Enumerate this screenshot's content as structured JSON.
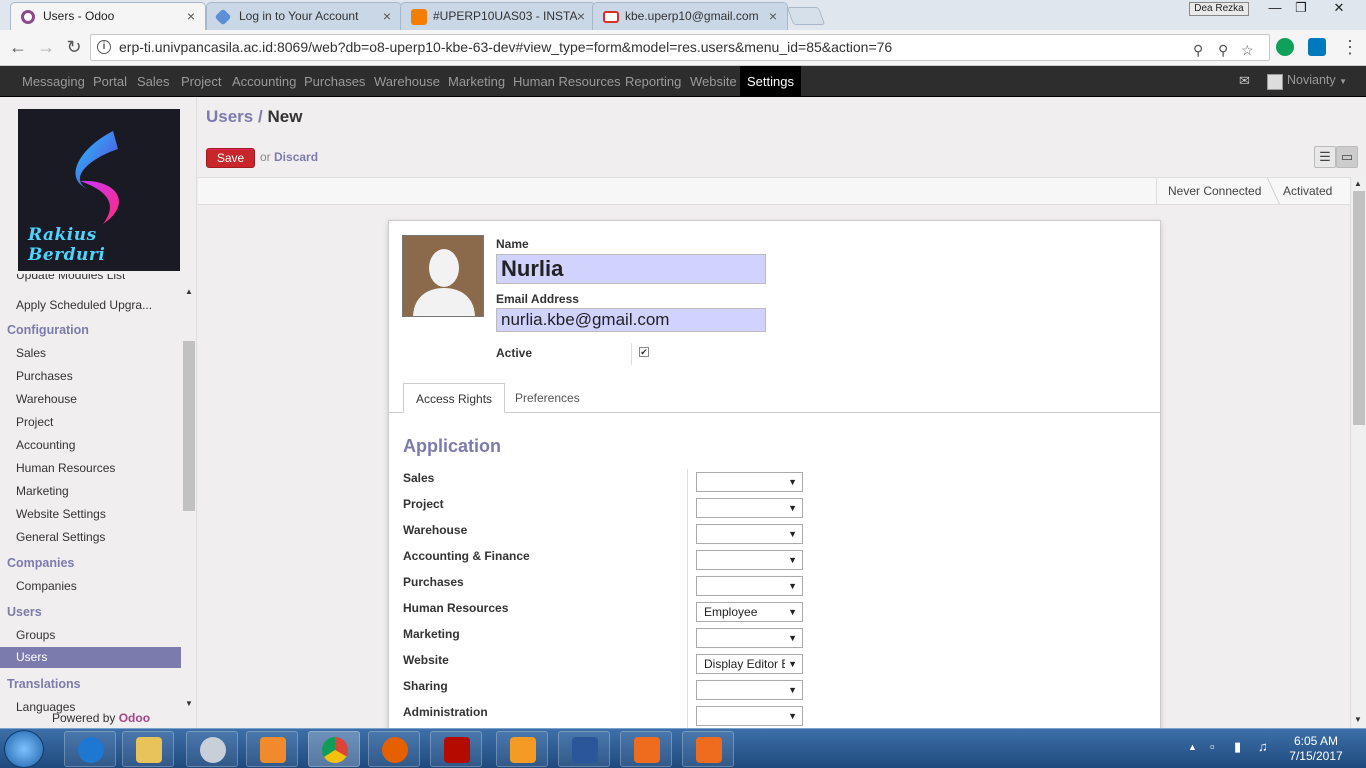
{
  "browser": {
    "tabs": [
      {
        "title": "Users - Odoo",
        "close": "×"
      },
      {
        "title": "Log in to Your Account",
        "close": "×"
      },
      {
        "title": "#UPERP10UAS03 - INSTA",
        "close": "×"
      },
      {
        "title": "kbe.uperp10@gmail.com",
        "close": "×"
      }
    ],
    "profile_name": "Dea Rezka",
    "url": "erp-ti.univpancasila.ac.id:8069/web?db=o8-uperp10-kbe-63-dev#view_type=form&model=res.users&menu_id=85&action=76",
    "window_buttons": {
      "minimize": "—",
      "restore": "❐",
      "close": "✕"
    }
  },
  "topmenu": {
    "items": [
      "Messaging",
      "Portal",
      "Sales",
      "Project",
      "Accounting",
      "Purchases",
      "Warehouse",
      "Marketing",
      "Human Resources",
      "Reporting",
      "Website",
      "Settings"
    ],
    "active": "Settings",
    "user": "Novianty"
  },
  "sidebar": {
    "logo_text": "Rakius Berduri",
    "partial_item": "Update Modules List",
    "items_top": [
      "Apply Scheduled Upgra..."
    ],
    "sections": [
      {
        "title": "Configuration",
        "items": [
          "Sales",
          "Purchases",
          "Warehouse",
          "Project",
          "Accounting",
          "Human Resources",
          "Marketing",
          "Website Settings",
          "General Settings"
        ]
      },
      {
        "title": "Companies",
        "items": [
          "Companies"
        ]
      },
      {
        "title": "Users",
        "items": [
          "Groups",
          "Users"
        ]
      },
      {
        "title": "Translations",
        "items": [
          "Languages"
        ]
      }
    ],
    "selected": "Users",
    "powered_by": "Powered by",
    "powered_brand": "Odoo"
  },
  "main": {
    "breadcrumb_parent": "Users",
    "breadcrumb_sep": "/",
    "breadcrumb_current": "New",
    "save_label": "Save",
    "or_label": "or",
    "discard_label": "Discard",
    "stages": [
      "Never Connected",
      "Activated"
    ]
  },
  "form": {
    "name_label": "Name",
    "name_value": "Nurlia",
    "email_label": "Email Address",
    "email_value": "nurlia.kbe@gmail.com",
    "active_label": "Active",
    "active_checked": true,
    "tabs": [
      "Access Rights",
      "Preferences"
    ],
    "active_tab": "Access Rights",
    "application_heading": "Application",
    "rows": [
      {
        "label": "Sales",
        "value": ""
      },
      {
        "label": "Project",
        "value": ""
      },
      {
        "label": "Warehouse",
        "value": ""
      },
      {
        "label": "Accounting & Finance",
        "value": ""
      },
      {
        "label": "Purchases",
        "value": ""
      },
      {
        "label": "Human Resources",
        "value": "Employee"
      },
      {
        "label": "Marketing",
        "value": ""
      },
      {
        "label": "Website",
        "value": "Display Editor B"
      },
      {
        "label": "Sharing",
        "value": ""
      },
      {
        "label": "Administration",
        "value": ""
      }
    ]
  },
  "taskbar": {
    "time": "6:05 AM",
    "date": "7/15/2017"
  },
  "colors": {
    "accent": "#7c7bad",
    "save_button": "#c8262a",
    "topmenu_bg": "#2d2d2d",
    "field_highlight": "#d2d2ff"
  }
}
